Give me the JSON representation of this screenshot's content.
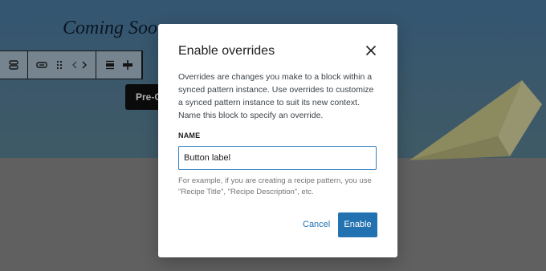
{
  "canvas": {
    "heading": "Coming Soon",
    "preorder_button": "Pre-O"
  },
  "toolbar": {
    "icons": [
      "block-type-icon",
      "row-icon",
      "drag-handle-icon",
      "move-arrows-icon",
      "align-icon",
      "justify-icon"
    ]
  },
  "modal": {
    "title": "Enable overrides",
    "description": "Overrides are changes you make to a block within a synced pattern instance. Use overrides to customize a synced pattern instance to suit its new context. Name this block to specify an override.",
    "name_label": "NAME",
    "name_value": "Button label",
    "help_text": "For example, if you are creating a recipe pattern, you use \"Recipe Title\", \"Recipe Description\", etc.",
    "cancel_label": "Cancel",
    "enable_label": "Enable"
  },
  "colors": {
    "accent": "#2271b1",
    "input_focus": "#3582c4"
  }
}
